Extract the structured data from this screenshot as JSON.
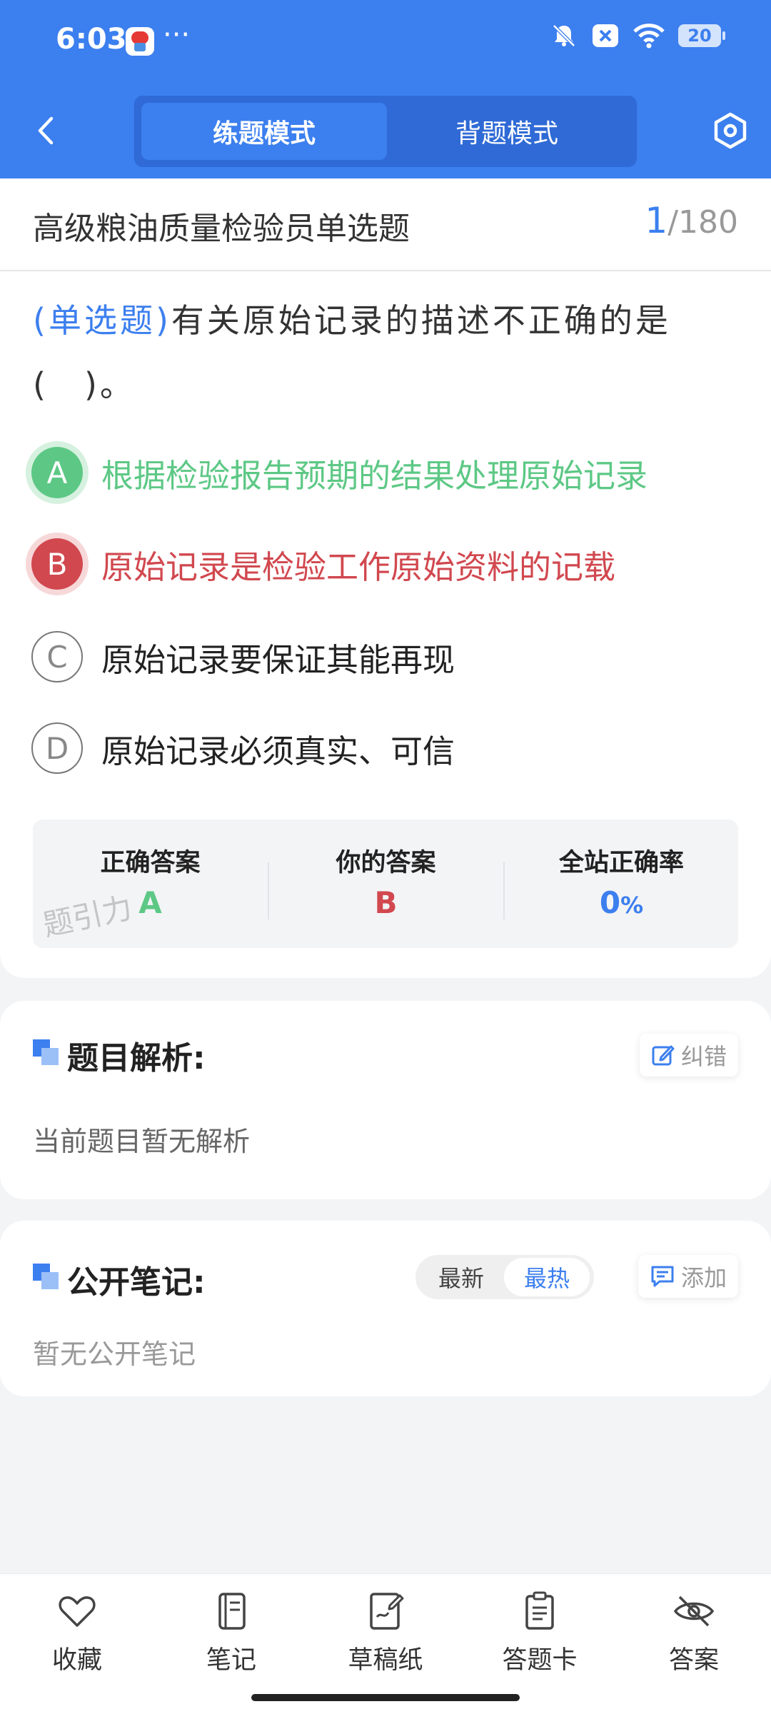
{
  "status_bar": {
    "time": "6:03",
    "dots": "···",
    "battery": "20",
    "icons": [
      "app-avatar-icon",
      "mute-bell-icon",
      "close-box-icon",
      "wifi-icon",
      "battery-icon"
    ]
  },
  "nav": {
    "mode_practice": "练题模式",
    "mode_memorize": "背题模式",
    "active_mode": "练题模式"
  },
  "header": {
    "title": "高级粮油质量检验员单选题",
    "current": "1",
    "total": "/180"
  },
  "question": {
    "type_label": "(单选题)",
    "text": "有关原始记录的描述不正确的是(　)。"
  },
  "options": [
    {
      "letter": "A",
      "text": "根据检验报告预期的结果处理原始记录",
      "state": "correct"
    },
    {
      "letter": "B",
      "text": "原始记录是检验工作原始资料的记载",
      "state": "wrong"
    },
    {
      "letter": "C",
      "text": "原始记录要保证其能再现",
      "state": "normal"
    },
    {
      "letter": "D",
      "text": "原始记录必须真实、可信",
      "state": "normal"
    }
  ],
  "answer_summary": {
    "correct_label": "正确答案",
    "correct_value": "A",
    "yours_label": "你的答案",
    "yours_value": "B",
    "rate_label": "全站正确率",
    "rate_value": "0",
    "rate_unit": "%",
    "watermark": "题引力"
  },
  "analysis": {
    "title": "题目解析:",
    "report_button": "纠错",
    "body": "当前题目暂无解析"
  },
  "notes": {
    "title": "公开笔记:",
    "sort_latest": "最新",
    "sort_hot": "最热",
    "active_sort": "最热",
    "add_button": "添加",
    "body": "暂无公开笔记"
  },
  "bottom_bar": {
    "favorite": "收藏",
    "notes": "笔记",
    "scratch": "草稿纸",
    "answer_card": "答题卡",
    "answer": "答案"
  },
  "colors": {
    "primary": "#3c7fef",
    "correct": "#5dc885",
    "wrong": "#d1484f"
  }
}
